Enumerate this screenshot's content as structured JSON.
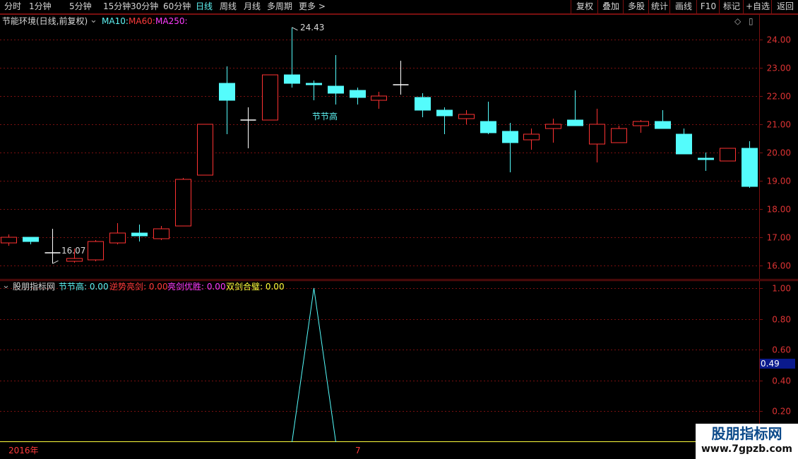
{
  "toolbar": {
    "left": [
      "分时",
      "1分钟",
      "5分钟",
      "15分钟",
      "30分钟",
      "60分钟",
      "日线",
      "周线",
      "月线",
      "多周期",
      "更多"
    ],
    "right": [
      "复权",
      "叠加",
      "多股",
      "统计",
      "画线",
      "F10",
      "标记",
      "+自选",
      "返回"
    ],
    "active": "日线"
  },
  "main": {
    "stock_title": "节能环境(日线,前复权)",
    "ma_labels": [
      {
        "text": "MA10:",
        "color": "#5ff5f5"
      },
      {
        "text": "MA60:",
        "color": "#ff3b3b"
      },
      {
        "text": "MA250:",
        "color": "#ff3cff"
      }
    ],
    "high_label": "24.43",
    "low_label": "16.07",
    "signal_label": "节节高",
    "price_ticks": [
      "24.00",
      "23.00",
      "22.00",
      "21.00",
      "20.00",
      "19.00",
      "18.00",
      "17.00",
      "16.00"
    ]
  },
  "indicator": {
    "name": "股朋指标网",
    "items": [
      {
        "text": "节节高: 0.00",
        "color": "#5ff5f5"
      },
      {
        "text": "逆势亮剑: 0.00",
        "color": "#ff3b3b"
      },
      {
        "text": "亮剑优胜: 0.00",
        "color": "#ff3cff"
      },
      {
        "text": "双剑合璧: 0.00",
        "color": "#ffff3c"
      }
    ],
    "ticks": [
      "1.00",
      "0.80",
      "0.60",
      "0.40",
      "0.20"
    ],
    "current_value": "0.49"
  },
  "time_axis": {
    "year": "2016年",
    "month": "7"
  },
  "watermark": {
    "title": "股朋指标网",
    "url": "www.7gpzb.com"
  },
  "colors": {
    "up": "#ff3232",
    "down": "#54fcfc",
    "grid": "#7a1010",
    "indicator_line": "#54fcfc",
    "baseline": "#ffff3c"
  },
  "chart_data": [
    {
      "type": "candlestick",
      "title": "节能环境(日线,前复权)",
      "ylim": [
        15.5,
        24.9
      ],
      "y_ticks": [
        16,
        17,
        18,
        19,
        20,
        21,
        22,
        23,
        24
      ],
      "candles": [
        {
          "o": 16.8,
          "h": 17.1,
          "l": 16.7,
          "c": 17.0
        },
        {
          "o": 17.0,
          "h": 17.0,
          "l": 16.75,
          "c": 16.85
        },
        {
          "o": 16.45,
          "h": 17.3,
          "l": 16.07,
          "c": 16.45
        },
        {
          "o": 16.15,
          "h": 16.6,
          "l": 16.1,
          "c": 16.25
        },
        {
          "o": 16.2,
          "h": 16.9,
          "l": 16.15,
          "c": 16.85
        },
        {
          "o": 16.8,
          "h": 17.5,
          "l": 16.75,
          "c": 17.15
        },
        {
          "o": 17.15,
          "h": 17.45,
          "l": 16.85,
          "c": 17.05
        },
        {
          "o": 16.95,
          "h": 17.4,
          "l": 16.9,
          "c": 17.3
        },
        {
          "o": 17.4,
          "h": 19.1,
          "l": 17.4,
          "c": 19.05
        },
        {
          "o": 19.2,
          "h": 21.0,
          "l": 19.2,
          "c": 21.0
        },
        {
          "o": 22.45,
          "h": 23.05,
          "l": 20.65,
          "c": 21.85
        },
        {
          "o": 21.15,
          "h": 21.6,
          "l": 20.15,
          "c": 21.15
        },
        {
          "o": 21.15,
          "h": 22.75,
          "l": 21.15,
          "c": 22.75
        },
        {
          "o": 22.75,
          "h": 24.43,
          "l": 22.3,
          "c": 22.45
        },
        {
          "o": 22.45,
          "h": 22.55,
          "l": 21.85,
          "c": 22.4
        },
        {
          "o": 22.35,
          "h": 23.45,
          "l": 21.7,
          "c": 22.1
        },
        {
          "o": 22.2,
          "h": 22.3,
          "l": 21.7,
          "c": 21.95
        },
        {
          "o": 21.85,
          "h": 22.15,
          "l": 21.55,
          "c": 22.0
        },
        {
          "o": 22.4,
          "h": 23.25,
          "l": 22.05,
          "c": 22.4
        },
        {
          "o": 21.95,
          "h": 22.1,
          "l": 21.25,
          "c": 21.5
        },
        {
          "o": 21.5,
          "h": 21.6,
          "l": 20.65,
          "c": 21.3
        },
        {
          "o": 21.2,
          "h": 21.5,
          "l": 21.0,
          "c": 21.35
        },
        {
          "o": 21.1,
          "h": 21.8,
          "l": 20.65,
          "c": 20.7
        },
        {
          "o": 20.75,
          "h": 21.05,
          "l": 19.3,
          "c": 20.35
        },
        {
          "o": 20.45,
          "h": 20.85,
          "l": 20.1,
          "c": 20.65
        },
        {
          "o": 20.85,
          "h": 21.2,
          "l": 20.35,
          "c": 21.0
        },
        {
          "o": 21.15,
          "h": 22.2,
          "l": 20.95,
          "c": 20.95
        },
        {
          "o": 20.3,
          "h": 21.55,
          "l": 19.65,
          "c": 21.0
        },
        {
          "o": 20.35,
          "h": 20.95,
          "l": 20.35,
          "c": 20.85
        },
        {
          "o": 20.95,
          "h": 21.15,
          "l": 20.7,
          "c": 21.1
        },
        {
          "o": 21.1,
          "h": 21.5,
          "l": 20.85,
          "c": 20.85
        },
        {
          "o": 20.65,
          "h": 20.85,
          "l": 19.95,
          "c": 19.95
        },
        {
          "o": 19.8,
          "h": 20.0,
          "l": 19.35,
          "c": 19.75
        },
        {
          "o": 19.7,
          "h": 20.1,
          "l": 19.7,
          "c": 20.15
        },
        {
          "o": 20.15,
          "h": 20.4,
          "l": 18.75,
          "c": 18.8
        }
      ]
    },
    {
      "type": "line",
      "title": "股朋指标网",
      "ylim": [
        0.0,
        1.05
      ],
      "y_ticks": [
        0.2,
        0.4,
        0.6,
        0.8,
        1.0
      ],
      "series": [
        {
          "name": "节节高",
          "values": [
            0,
            0,
            0,
            0,
            0,
            0,
            0,
            0,
            0,
            0,
            0,
            0,
            0,
            0,
            1,
            0,
            0,
            0,
            0,
            0,
            0,
            0,
            0,
            0,
            0,
            0,
            0,
            0,
            0,
            0,
            0,
            0,
            0,
            0,
            0
          ]
        }
      ]
    }
  ]
}
